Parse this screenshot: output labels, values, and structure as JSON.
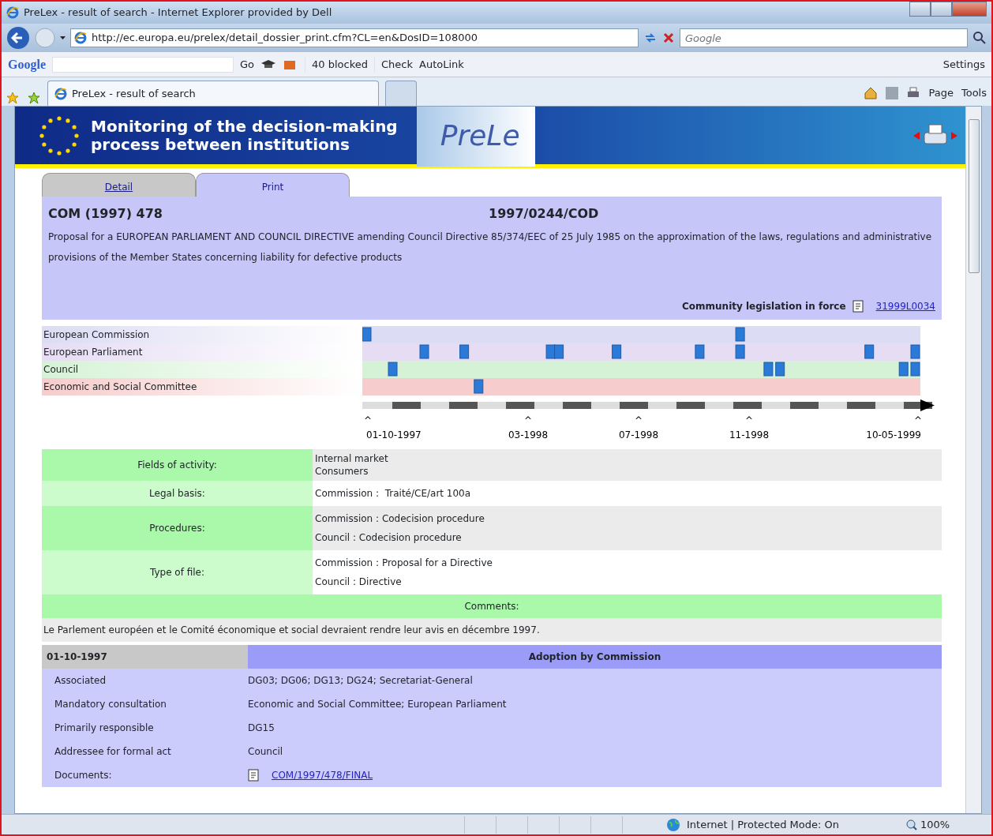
{
  "window": {
    "title": "PreLex - result of search - Internet Explorer provided by Dell"
  },
  "address_bar": {
    "url": "http://ec.europa.eu/prelex/detail_dossier_print.cfm?CL=en&DosID=108000",
    "search_placeholder": "Google"
  },
  "google_toolbar": {
    "logo": "Google",
    "go": "Go",
    "blocked": "40 blocked",
    "check": "Check",
    "autolink": "AutoLink",
    "settings": "Settings"
  },
  "tabs": [
    {
      "label": "PreLex - result of search",
      "selected": true
    }
  ],
  "command_bar": {
    "page": "Page",
    "tools": "Tools"
  },
  "banner": {
    "title_lines": [
      "Monitoring of the decision-making",
      "process between institutions"
    ],
    "logo": "PreLe"
  },
  "page_tabs": [
    {
      "label": "Detail",
      "selected": false
    },
    {
      "label": "Print",
      "selected": true
    }
  ],
  "dossier": {
    "reference": "COM (1997) 478",
    "procedure": "1997/0244/COD",
    "title": "Proposal for a EUROPEAN PARLIAMENT AND COUNCIL DIRECTIVE amending Council Directive 85/374/EEC of 25 July 1985 on the approximation of the laws, regulations and administrative provisions of the Member States concerning liability for defective products",
    "legislation_label": "Community legislation in force",
    "legislation_link": "31999L0034"
  },
  "timeline": {
    "rows": [
      {
        "label": "European Commission",
        "color": "#dcdcf4",
        "markers": [
          {
            "level": 0
          },
          {
            "level": 0.674
          }
        ]
      },
      {
        "label": "European Parliament",
        "color": "#e6dcf4",
        "markers": [
          {
            "level": 0.104
          },
          {
            "level": 0.176
          },
          {
            "level": 0.332
          },
          {
            "level": 0.347
          },
          {
            "level": 0.451
          },
          {
            "level": 0.601
          },
          {
            "level": 0.674
          },
          {
            "level": 0.907
          },
          {
            "level": 0.99
          }
        ]
      },
      {
        "label": "Council",
        "color": "#d6f2d6",
        "markers": [
          {
            "level": 0.047
          },
          {
            "level": 0.725
          },
          {
            "level": 0.746
          },
          {
            "level": 0.969
          },
          {
            "level": 0.99
          }
        ]
      },
      {
        "label": "Economic and Social Committee",
        "color": "#f6cccc",
        "markers": [
          {
            "level": 0.202
          }
        ]
      }
    ],
    "date_marks": [
      {
        "mark": "^",
        "date": "01-10-1997"
      },
      {
        "mark": "^",
        "date": "03-1998"
      },
      {
        "mark": "^",
        "date": "07-1998"
      },
      {
        "mark": "^",
        "date": "11-1998"
      },
      {
        "mark": "^",
        "date": "10-05-1999"
      }
    ]
  },
  "fields": [
    {
      "label": "Fields of activity:",
      "values": [
        "Internal market",
        "Consumers"
      ]
    },
    {
      "label": "Legal basis:",
      "values": [
        "Commission :  Traité/CE/art 100a"
      ]
    },
    {
      "label": "Procedures:",
      "values": [
        "Commission : Codecision procedure",
        "Council : Codecision procedure"
      ]
    },
    {
      "label": "Type of file:",
      "values": [
        "Commission : Proposal for a Directive",
        "Council : Directive"
      ]
    }
  ],
  "comments": {
    "header": "Comments:",
    "text": "Le Parlement européen et le Comité économique et social devraient rendre leur avis en décembre 1997."
  },
  "event": {
    "date": "01-10-1997",
    "title": "Adoption by Commission",
    "rows": [
      {
        "label": "Associated",
        "kind": "text",
        "value": "DG03; DG06; DG13; DG24; Secretariat-General"
      },
      {
        "label": "Mandatory consultation",
        "kind": "text",
        "value": "Economic and Social Committee; European Parliament"
      },
      {
        "label": "Primarily responsible",
        "kind": "text",
        "value": "DG15"
      },
      {
        "label": "Addressee for formal act",
        "kind": "text",
        "value": "Council"
      },
      {
        "label": "Documents:",
        "kind": "link",
        "value": "COM/1997/478/FINAL"
      }
    ]
  },
  "status_bar": {
    "zone": "Internet | Protected Mode: On",
    "zoom": "100%"
  }
}
